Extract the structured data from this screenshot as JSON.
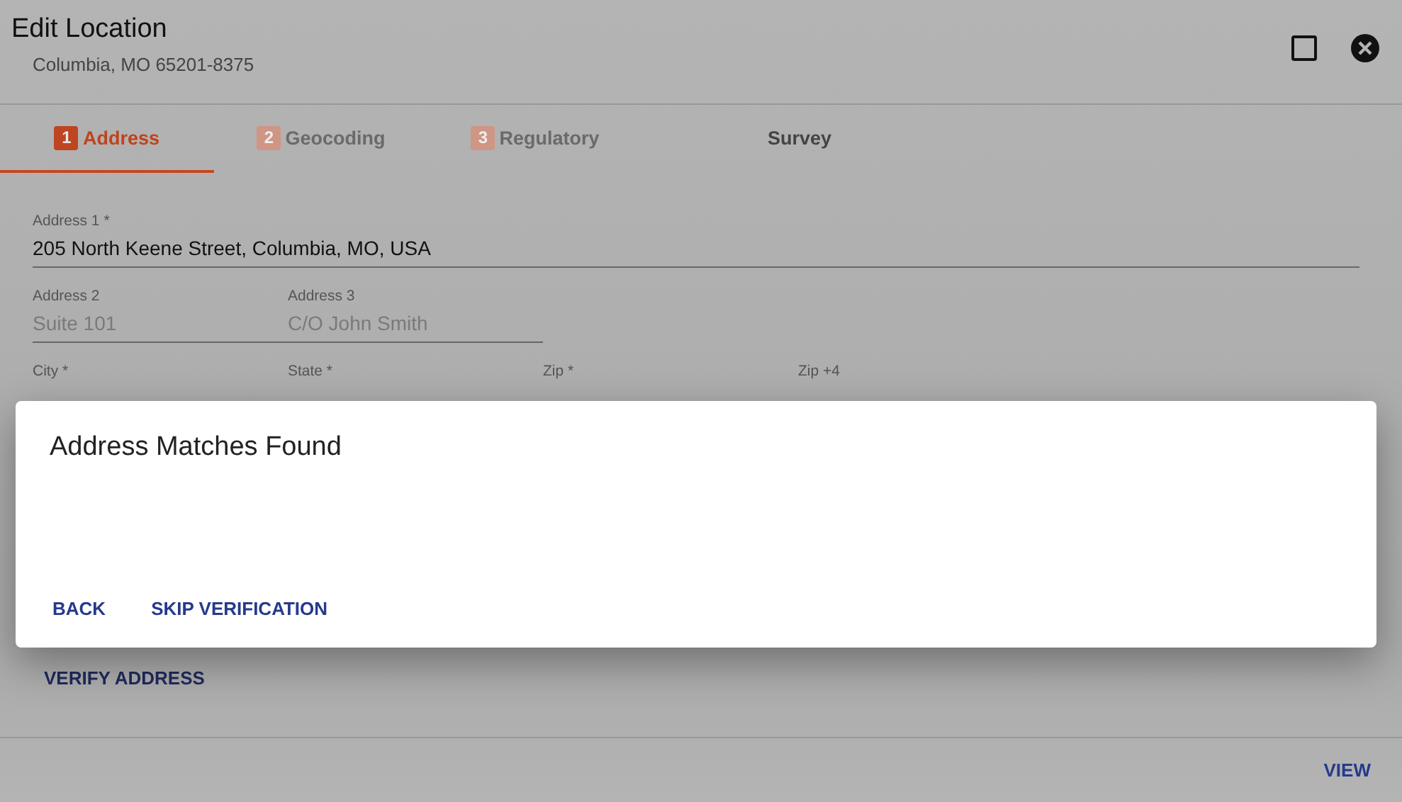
{
  "window": {
    "title": "Edit Location",
    "subtitle": "Columbia, MO 65201-8375"
  },
  "tabs": [
    {
      "number": "1",
      "label": "Address",
      "selected": true,
      "disabled": false
    },
    {
      "number": "2",
      "label": "Geocoding",
      "selected": false,
      "disabled": true
    },
    {
      "number": "3",
      "label": "Regulatory",
      "selected": false,
      "disabled": true
    },
    {
      "label": "Survey",
      "selected": false,
      "disabled": false
    }
  ],
  "form": {
    "rows": [
      [
        {
          "label": "Address 1 *",
          "value": "205 North Keene Street, Columbia, MO, USA"
        }
      ],
      [
        {
          "label": "Address 2",
          "placeholder": "Suite 101"
        },
        {
          "label": "Address 3",
          "placeholder": "C/O John Smith"
        }
      ],
      [
        {
          "label": "City *"
        },
        {
          "label": "State *"
        },
        {
          "label": "Zip *"
        },
        {
          "label": "Zip +4"
        }
      ]
    ],
    "verify_button": "VERIFY ADDRESS"
  },
  "footer": {
    "buttons": [
      "VIEW"
    ]
  },
  "dialog": {
    "title": "Address Matches Found",
    "buttons": [
      "BACK",
      "SKIP VERIFICATION"
    ]
  }
}
